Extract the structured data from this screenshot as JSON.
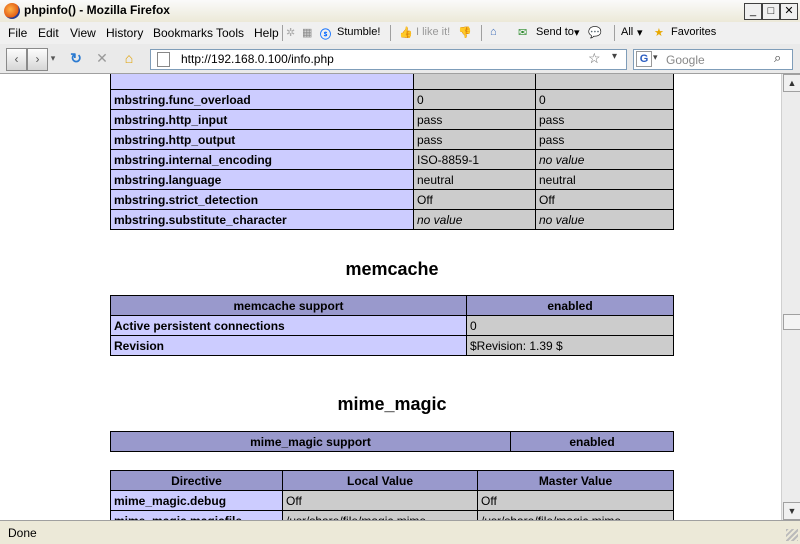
{
  "window": {
    "title": "phpinfo() - Mozilla Firefox"
  },
  "menu": {
    "items": [
      "File",
      "Edit",
      "View",
      "History",
      "Bookmarks",
      "Tools",
      "Help"
    ]
  },
  "toolbar": {
    "stumble": "Stumble!",
    "ilike": "I like it!",
    "sendto": "Send to",
    "all": "All",
    "favorites": "Favorites"
  },
  "nav": {
    "url": "http://192.168.0.100/info.php",
    "search_placeholder": "Google"
  },
  "mbstring": {
    "rows": [
      {
        "d": "mbstring.func_overload",
        "l": "0",
        "m": "0",
        "li": false,
        "mi": false
      },
      {
        "d": "mbstring.http_input",
        "l": "pass",
        "m": "pass",
        "li": false,
        "mi": false
      },
      {
        "d": "mbstring.http_output",
        "l": "pass",
        "m": "pass",
        "li": false,
        "mi": false
      },
      {
        "d": "mbstring.internal_encoding",
        "l": "ISO-8859-1",
        "m": "no value",
        "li": false,
        "mi": true
      },
      {
        "d": "mbstring.language",
        "l": "neutral",
        "m": "neutral",
        "li": false,
        "mi": false
      },
      {
        "d": "mbstring.strict_detection",
        "l": "Off",
        "m": "Off",
        "li": false,
        "mi": false
      },
      {
        "d": "mbstring.substitute_character",
        "l": "no value",
        "m": "no value",
        "li": true,
        "mi": true
      }
    ]
  },
  "memcache": {
    "title": "memcache",
    "support_label": "memcache support",
    "support_value": "enabled",
    "rows": [
      {
        "k": "Active persistent connections",
        "v": "0"
      },
      {
        "k": "Revision",
        "v": "$Revision: 1.39 $"
      }
    ]
  },
  "mime_magic": {
    "title": "mime_magic",
    "support_label": "mime_magic support",
    "support_value": "enabled",
    "headers": [
      "Directive",
      "Local Value",
      "Master Value"
    ],
    "rows": [
      {
        "d": "mime_magic.debug",
        "l": "Off",
        "m": "Off"
      },
      {
        "d": "mime_magic.magicfile",
        "l": "/usr/share/file/magic.mime",
        "m": "/usr/share/file/magic.mime"
      }
    ]
  },
  "status": {
    "text": "Done"
  }
}
